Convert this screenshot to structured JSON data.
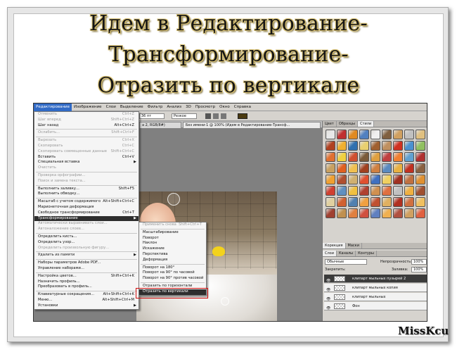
{
  "heading": {
    "line1": "Идем в Редактирование-",
    "line2": "Трансформирование-",
    "line3": "Отразить по вертикале"
  },
  "signature": "MissKcu",
  "menubar": [
    "Редактирование",
    "Изображение",
    "Слои",
    "Выделение",
    "Фильтр",
    "Анализ",
    "3D",
    "Просмотр",
    "Окно",
    "Справка"
  ],
  "options": {
    "font_size": "36 пт",
    "antialias": "Резкое"
  },
  "doc_tabs": [
    "а 2, RGB/8#)",
    "Без имени-1 @ 100% (Идем в Редактирование-Трансф..."
  ],
  "panel": {
    "top_tabs": [
      "Цвет",
      "Образцы",
      "Стили"
    ],
    "layer_tabs_a": [
      "Корекция",
      "Маски"
    ],
    "layer_tabs_b": [
      "Слои",
      "Каналы",
      "Контуры"
    ],
    "blend_mode": "Обычные",
    "opacity_label": "Непрозрачность:",
    "opacity_value": "100%",
    "lock_label": "Закрепить:",
    "fill_label": "Заливка:",
    "fill_value": "100%",
    "layers": [
      {
        "name": "клипарт мыльных пузырей 2",
        "selected": true
      },
      {
        "name": "клипарт мыльных копия",
        "selected": false
      },
      {
        "name": "клипарт мыльных",
        "selected": false
      },
      {
        "name": "Фон",
        "selected": false
      }
    ]
  },
  "style_colors": [
    "#e8e8e8",
    "#c03030",
    "#e08a20",
    "#5080c0",
    "#f0f0f0",
    "#806040",
    "#d0a060",
    "#c0c0c0",
    "#e0c080",
    "#b04020",
    "#f0b030",
    "#3070b0",
    "#e8d070",
    "#a06030",
    "#c09060",
    "#d03020",
    "#4a90d0",
    "#90c060",
    "#e07030",
    "#f0d040",
    "#d05030",
    "#7a5a3a",
    "#e0a040",
    "#c04040",
    "#f08030",
    "#60a0d0",
    "#b03030",
    "#c8a060",
    "#e06020",
    "#f0c050",
    "#a04020",
    "#d08040",
    "#5a8ac0",
    "#e8b040",
    "#c03020",
    "#8a6040",
    "#f0a030",
    "#b05030",
    "#d0b070",
    "#e05030",
    "#4070c0",
    "#f0d060",
    "#a03020",
    "#c07040",
    "#e09030",
    "#d04030",
    "#6090c0",
    "#f0c040",
    "#b04030",
    "#d09050",
    "#e07040",
    "#c0c0c0",
    "#f0b040",
    "#a05030",
    "#e0d0a0",
    "#d06030",
    "#5080b0",
    "#f0a040",
    "#c05030",
    "#e0b060",
    "#b03020",
    "#d07040",
    "#f0c060",
    "#a04030",
    "#c09050",
    "#e08040",
    "#d05040",
    "#6080c0",
    "#f0b050",
    "#b05040",
    "#d0a060",
    "#e06040"
  ],
  "edit_menu": [
    {
      "label": "Отменить",
      "shortcut": "Ctrl+Z",
      "disabled": true
    },
    {
      "label": "Шаг вперед",
      "shortcut": "Shift+Ctrl+Z",
      "disabled": true
    },
    {
      "label": "Шаг назад",
      "shortcut": "Alt+Ctrl+Z",
      "disabled": false
    },
    {
      "sep": true
    },
    {
      "label": "Ослабить...",
      "shortcut": "Shift+Ctrl+F",
      "disabled": true
    },
    {
      "sep": true
    },
    {
      "label": "Вырезать",
      "shortcut": "Ctrl+X",
      "disabled": true
    },
    {
      "label": "Скопировать",
      "shortcut": "Ctrl+C",
      "disabled": true
    },
    {
      "label": "Скопировать совмещенные данные",
      "shortcut": "Shift+Ctrl+C",
      "disabled": true
    },
    {
      "label": "Вставить",
      "shortcut": "Ctrl+V",
      "disabled": false
    },
    {
      "label": "Специальная вставка",
      "shortcut": "",
      "disabled": false,
      "arrow": true
    },
    {
      "label": "Очистить",
      "shortcut": "",
      "disabled": true
    },
    {
      "sep": true
    },
    {
      "label": "Проверка орфографии...",
      "shortcut": "",
      "disabled": true
    },
    {
      "label": "Поиск и замена текста...",
      "shortcut": "",
      "disabled": true
    },
    {
      "sep": true
    },
    {
      "label": "Выполнить заливку...",
      "shortcut": "Shift+F5",
      "disabled": false
    },
    {
      "label": "Выполнить обводку...",
      "shortcut": "",
      "disabled": false
    },
    {
      "sep": true
    },
    {
      "label": "Масштаб с учетом содержимого",
      "shortcut": "Alt+Shift+Ctrl+C",
      "disabled": false
    },
    {
      "label": "Марионеточная деформация",
      "shortcut": "",
      "disabled": false
    },
    {
      "label": "Свободное трансформирование",
      "shortcut": "Ctrl+T",
      "disabled": false
    },
    {
      "label": "Трансформирование",
      "shortcut": "",
      "disabled": false,
      "arrow": true,
      "highlight": true
    },
    {
      "label": "Автоматически выравнивать слои...",
      "shortcut": "",
      "disabled": true
    },
    {
      "label": "Автоналожение слоев...",
      "shortcut": "",
      "disabled": true
    },
    {
      "sep": true
    },
    {
      "label": "Определить кисть...",
      "shortcut": "",
      "disabled": false
    },
    {
      "label": "Определить узор...",
      "shortcut": "",
      "disabled": false
    },
    {
      "label": "Определить произвольную фигуру...",
      "shortcut": "",
      "disabled": true
    },
    {
      "sep": true
    },
    {
      "label": "Удалить из памяти",
      "shortcut": "",
      "disabled": false,
      "arrow": true
    },
    {
      "sep": true
    },
    {
      "label": "Наборы параметров Adobe PDF...",
      "shortcut": "",
      "disabled": false
    },
    {
      "label": "Управление наборами...",
      "shortcut": "",
      "disabled": false
    },
    {
      "sep": true
    },
    {
      "label": "Настройка цветов...",
      "shortcut": "Shift+Ctrl+K",
      "disabled": false
    },
    {
      "label": "Назначить профиль...",
      "shortcut": "",
      "disabled": false
    },
    {
      "label": "Преобразовать в профиль...",
      "shortcut": "",
      "disabled": false
    },
    {
      "sep": true
    },
    {
      "label": "Клавиатурные сокращения...",
      "shortcut": "Alt+Shift+Ctrl+K",
      "disabled": false
    },
    {
      "label": "Меню...",
      "shortcut": "Alt+Shift+Ctrl+M",
      "disabled": false
    },
    {
      "label": "Установки",
      "shortcut": "",
      "disabled": false,
      "arrow": true
    }
  ],
  "transform_menu": [
    {
      "label": "Применить снова",
      "shortcut": "Shift+Ctrl+T",
      "disabled": true
    },
    {
      "sep": true
    },
    {
      "label": "Масштабирование",
      "shortcut": "",
      "disabled": false
    },
    {
      "label": "Поворот",
      "shortcut": "",
      "disabled": false
    },
    {
      "label": "Наклон",
      "shortcut": "",
      "disabled": false
    },
    {
      "label": "Искажение",
      "shortcut": "",
      "disabled": false
    },
    {
      "label": "Перспектива",
      "shortcut": "",
      "disabled": false
    },
    {
      "label": "Деформация",
      "shortcut": "",
      "disabled": false
    },
    {
      "sep": true
    },
    {
      "label": "Поворот на 180°",
      "shortcut": "",
      "disabled": false
    },
    {
      "label": "Поворот на 90° по часовой",
      "shortcut": "",
      "disabled": false
    },
    {
      "label": "Поворот на 90° против часовой",
      "shortcut": "",
      "disabled": false
    },
    {
      "sep": true
    },
    {
      "label": "Отразить по горизонтали",
      "shortcut": "",
      "disabled": false
    },
    {
      "label": "Отразить по вертикали",
      "shortcut": "",
      "disabled": false,
      "highlight": true
    }
  ],
  "colors": {
    "highlight": "#2e2e2e",
    "callout": "#d01010",
    "menu_active": "#316ac5"
  }
}
